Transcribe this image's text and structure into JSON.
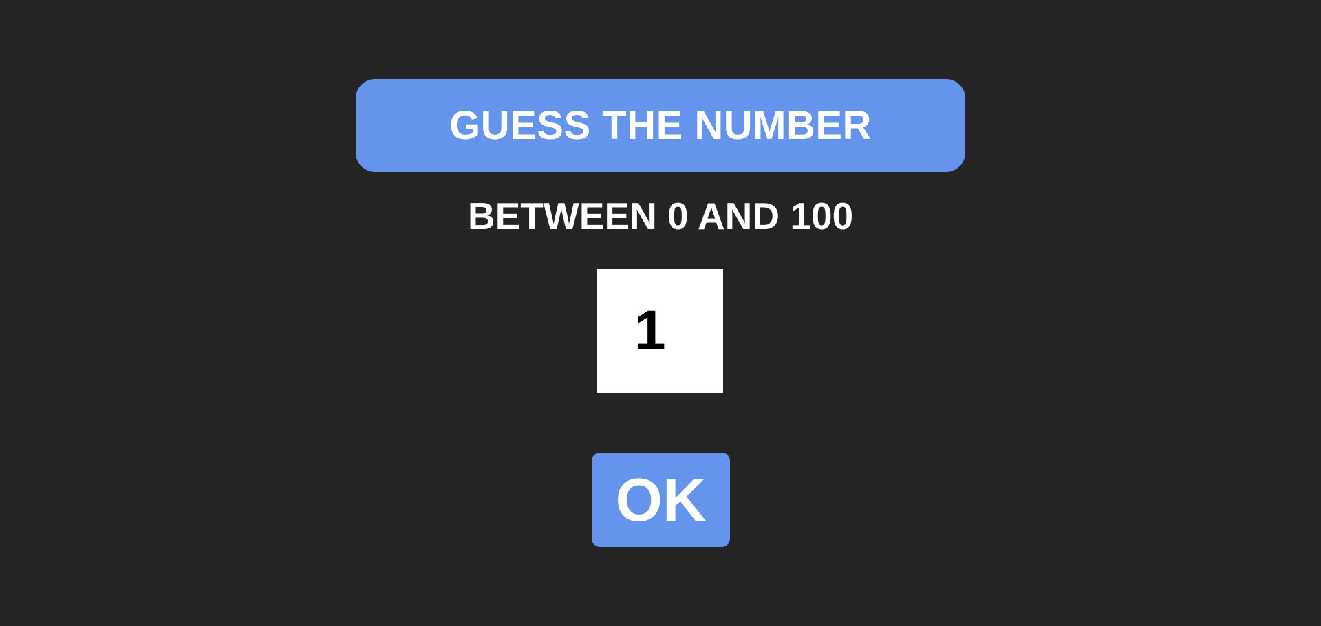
{
  "header": {
    "title": "GUESS THE NUMBER"
  },
  "prompt": {
    "range_text": "BETWEEN 0 AND 100"
  },
  "guess": {
    "value": "1"
  },
  "actions": {
    "ok_label": "OK"
  },
  "colors": {
    "background": "#242424",
    "accent": "#6594ec",
    "text": "#ffffff",
    "input_background": "#ffffff",
    "input_text": "#000000"
  }
}
